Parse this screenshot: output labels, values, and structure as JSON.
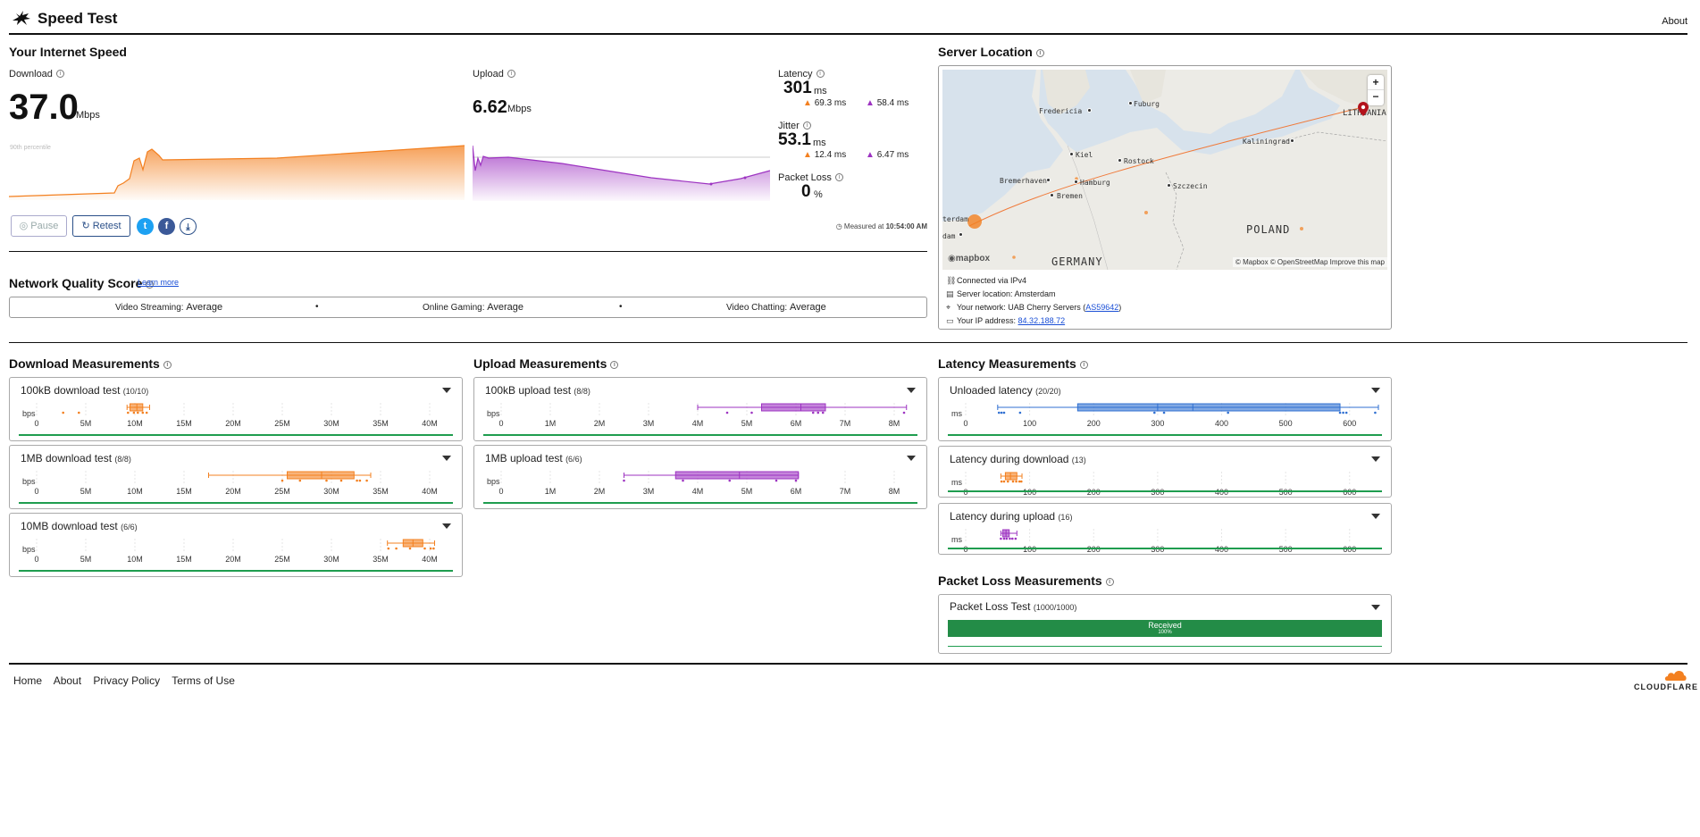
{
  "header": {
    "title": "Speed Test",
    "about_label": "About"
  },
  "speed": {
    "section_title": "Your Internet Speed",
    "download_label": "Download",
    "download_value": "37.0",
    "download_unit": "Mbps",
    "percentile_label": "90th percentile",
    "upload_label": "Upload",
    "upload_value": "6.62",
    "upload_unit": "Mbps",
    "latency_label": "Latency",
    "latency_value": "301",
    "latency_unit": "ms",
    "latency_down": "69.3 ms",
    "latency_up": "58.4 ms",
    "jitter_label": "Jitter",
    "jitter_value": "53.1",
    "jitter_unit": "ms",
    "jitter_down": "12.4 ms",
    "jitter_up": "6.47 ms",
    "packet_loss_label": "Packet Loss",
    "packet_loss_value": "0",
    "packet_loss_unit": "%",
    "pause_label": "Pause",
    "retest_label": "Retest",
    "measured_prefix": "Measured at",
    "measured_time": "10:54:00 AM",
    "colors": {
      "download": "#f38020",
      "upload": "#9d33c1",
      "latency": "#2f6fd1"
    }
  },
  "quality": {
    "title": "Network Quality Score",
    "learn_more": "Learn more",
    "items": [
      {
        "label": "Video Streaming:",
        "value": "Average"
      },
      {
        "label": "Online Gaming:",
        "value": "Average"
      },
      {
        "label": "Video Chatting:",
        "value": "Average"
      }
    ],
    "separator": "•"
  },
  "server": {
    "title": "Server Location",
    "map_labels": {
      "lithuania": "LITHUANIA",
      "poland": "POLAND",
      "germany": "GERMANY",
      "fuburg": "Fuburg",
      "frederica": "Fredericia",
      "kiel": "Kiel",
      "rostock": "Rostock",
      "kaliningrad": "Kaliningrad",
      "bremerhaven": "Bremerhaven",
      "hamburg": "Hamburg",
      "bremen": "Bremen",
      "szczecin": "Szczecin",
      "amsterdam": "terdam",
      "den": "dam"
    },
    "map_zoom_in": "+",
    "map_zoom_out": "−",
    "map_attribution": "© Mapbox © OpenStreetMap  Improve this map",
    "mapbox_logo": "mapbox",
    "connected": "Connected via IPv4",
    "location": "Server location: Amsterdam",
    "network_prefix": "Your network: UAB Cherry Servers (",
    "network_asn": "AS59642",
    "network_suffix": ")",
    "ip_prefix": "Your IP address: ",
    "ip_value": "84.32.188.72"
  },
  "download_measurements": {
    "title": "Download Measurements",
    "unit": "bps",
    "ticks": [
      "0",
      "5M",
      "10M",
      "15M",
      "20M",
      "25M",
      "30M",
      "35M",
      "40M"
    ],
    "max": 42,
    "tests": [
      {
        "name": "100kB download test",
        "count": "(10/10)",
        "whisker": [
          9.2,
          11.5
        ],
        "box": [
          9.5,
          10.8
        ],
        "median": 10.2,
        "points": [
          2.7,
          4.3,
          9.3,
          9.9,
          10.3,
          10.8,
          11.2
        ]
      },
      {
        "name": "1MB download test",
        "count": "(8/8)",
        "whisker": [
          17.5,
          34
        ],
        "box": [
          25.5,
          32.3
        ],
        "median": 29,
        "points": [
          25,
          26.8,
          29.5,
          31,
          32.6,
          32.9,
          33.6
        ]
      },
      {
        "name": "10MB download test",
        "count": "(6/6)",
        "whisker": [
          35.7,
          40.5
        ],
        "box": [
          37.3,
          39.3
        ],
        "median": 38.3,
        "points": [
          35.8,
          36.6,
          38,
          39.5,
          40.1,
          40.4
        ]
      }
    ]
  },
  "upload_measurements": {
    "title": "Upload Measurements",
    "unit": "bps",
    "ticks": [
      "0",
      "1M",
      "2M",
      "3M",
      "4M",
      "5M",
      "6M",
      "7M",
      "8M"
    ],
    "max": 8.4,
    "tests": [
      {
        "name": "100kB upload test",
        "count": "(8/8)",
        "whisker": [
          4,
          8.25
        ],
        "box": [
          5.3,
          6.6
        ],
        "median": 6.1,
        "points": [
          4.6,
          5.1,
          6.35,
          6.45,
          6.55,
          8.2
        ]
      },
      {
        "name": "1MB upload test",
        "count": "(6/6)",
        "whisker": [
          2.5,
          6.05
        ],
        "box": [
          3.55,
          6.05
        ],
        "median": 4.85,
        "points": [
          2.5,
          3.7,
          4.65,
          5.6,
          6.0
        ]
      }
    ]
  },
  "latency_measurements": {
    "title": "Latency Measurements",
    "unit": "ms",
    "ticks": [
      "0",
      "100",
      "200",
      "300",
      "400",
      "500",
      "600"
    ],
    "tick_values": [
      0,
      100,
      200,
      300,
      400,
      500,
      600
    ],
    "max": 645,
    "tests": [
      {
        "name": "Unloaded latency",
        "count": "(20/20)",
        "whisker": [
          50,
          645
        ],
        "box": [
          175,
          585
        ],
        "median": 300,
        "q_extra": 355,
        "color": "#2f6fd1",
        "points": [
          52,
          56,
          60,
          85,
          295,
          310,
          410,
          585,
          590,
          595,
          640
        ]
      },
      {
        "name": "Latency during download",
        "count": "(13)",
        "whisker": [
          55,
          88
        ],
        "box": [
          62,
          80
        ],
        "median": 70,
        "color": "#f38020",
        "points": [
          56,
          60,
          66,
          74,
          79,
          84,
          87
        ]
      },
      {
        "name": "Latency during upload",
        "count": "(16)",
        "whisker": [
          55,
          80
        ],
        "box": [
          58,
          68
        ],
        "median": 63,
        "color": "#9d33c1",
        "points": [
          55,
          60,
          64,
          69,
          73,
          78
        ]
      }
    ]
  },
  "packet_loss_measurements": {
    "title": "Packet Loss Measurements",
    "test_name": "Packet Loss Test",
    "count": "(1000/1000)",
    "received_label": "Received",
    "received_pct": "100%",
    "received_fraction": 1.0
  },
  "footer": {
    "links": [
      "Home",
      "About",
      "Privacy Policy",
      "Terms of Use"
    ],
    "brand": "CLOUDFLARE"
  }
}
